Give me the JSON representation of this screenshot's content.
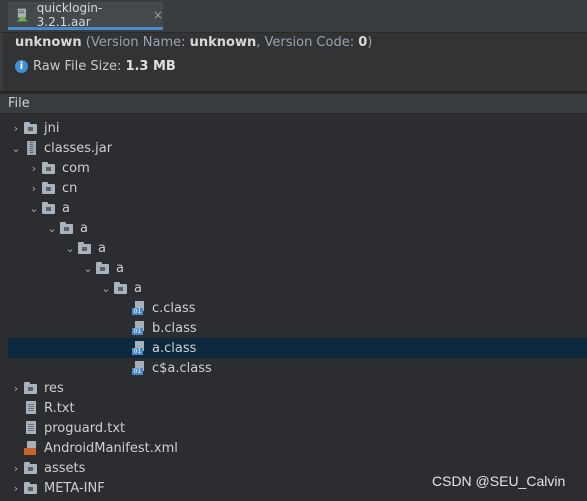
{
  "tab": {
    "label": "quicklogin-3.2.1.aar",
    "close": "×"
  },
  "info": {
    "name": "unknown",
    "version_prefix": " (Version Name: ",
    "version_name": "unknown",
    "version_middle": ", Version Code: ",
    "version_code": "0",
    "version_suffix": ")",
    "size_label": "Raw File Size: ",
    "size_value": "1.3 MB"
  },
  "file_header": "File",
  "tree": [
    {
      "label": "jni",
      "icon": "folder-icon",
      "arrow": "›",
      "depth": 0
    },
    {
      "label": "classes.jar",
      "icon": "jar-icon",
      "arrow": "⌄",
      "depth": 0
    },
    {
      "label": "com",
      "icon": "folder-icon",
      "arrow": "›",
      "depth": 1
    },
    {
      "label": "cn",
      "icon": "folder-icon",
      "arrow": "›",
      "depth": 1
    },
    {
      "label": "a",
      "icon": "folder-icon",
      "arrow": "⌄",
      "depth": 1
    },
    {
      "label": "a",
      "icon": "folder-icon",
      "arrow": "⌄",
      "depth": 2
    },
    {
      "label": "a",
      "icon": "folder-icon",
      "arrow": "⌄",
      "depth": 3
    },
    {
      "label": "a",
      "icon": "folder-icon",
      "arrow": "⌄",
      "depth": 4
    },
    {
      "label": "a",
      "icon": "folder-icon",
      "arrow": "⌄",
      "depth": 5
    },
    {
      "label": "c.class",
      "icon": "class-file-icon",
      "arrow": "",
      "depth": 6
    },
    {
      "label": "b.class",
      "icon": "class-file-icon",
      "arrow": "",
      "depth": 6
    },
    {
      "label": "a.class",
      "icon": "class-file-icon",
      "arrow": "",
      "depth": 6,
      "selected": true
    },
    {
      "label": "c$a.class",
      "icon": "class-file-icon",
      "arrow": "",
      "depth": 6
    },
    {
      "label": "res",
      "icon": "folder-icon",
      "arrow": "›",
      "depth": 0
    },
    {
      "label": "R.txt",
      "icon": "text-file-icon",
      "arrow": "",
      "depth": 0
    },
    {
      "label": "proguard.txt",
      "icon": "text-file-icon",
      "arrow": "",
      "depth": 0
    },
    {
      "label": "AndroidManifest.xml",
      "icon": "xml-file-icon",
      "arrow": "",
      "depth": 0
    },
    {
      "label": "assets",
      "icon": "folder-icon",
      "arrow": "›",
      "depth": 0
    },
    {
      "label": "META-INF",
      "icon": "folder-icon",
      "arrow": "›",
      "depth": 0
    }
  ],
  "watermark": "CSDN @SEU_Calvin",
  "colors": {
    "selection": "#0d293e",
    "tab_underline": "#4a88c7",
    "info_icon": "#3f8fd6",
    "class_badge": "#4b8bc8",
    "xml_badge": "#c9642d"
  }
}
